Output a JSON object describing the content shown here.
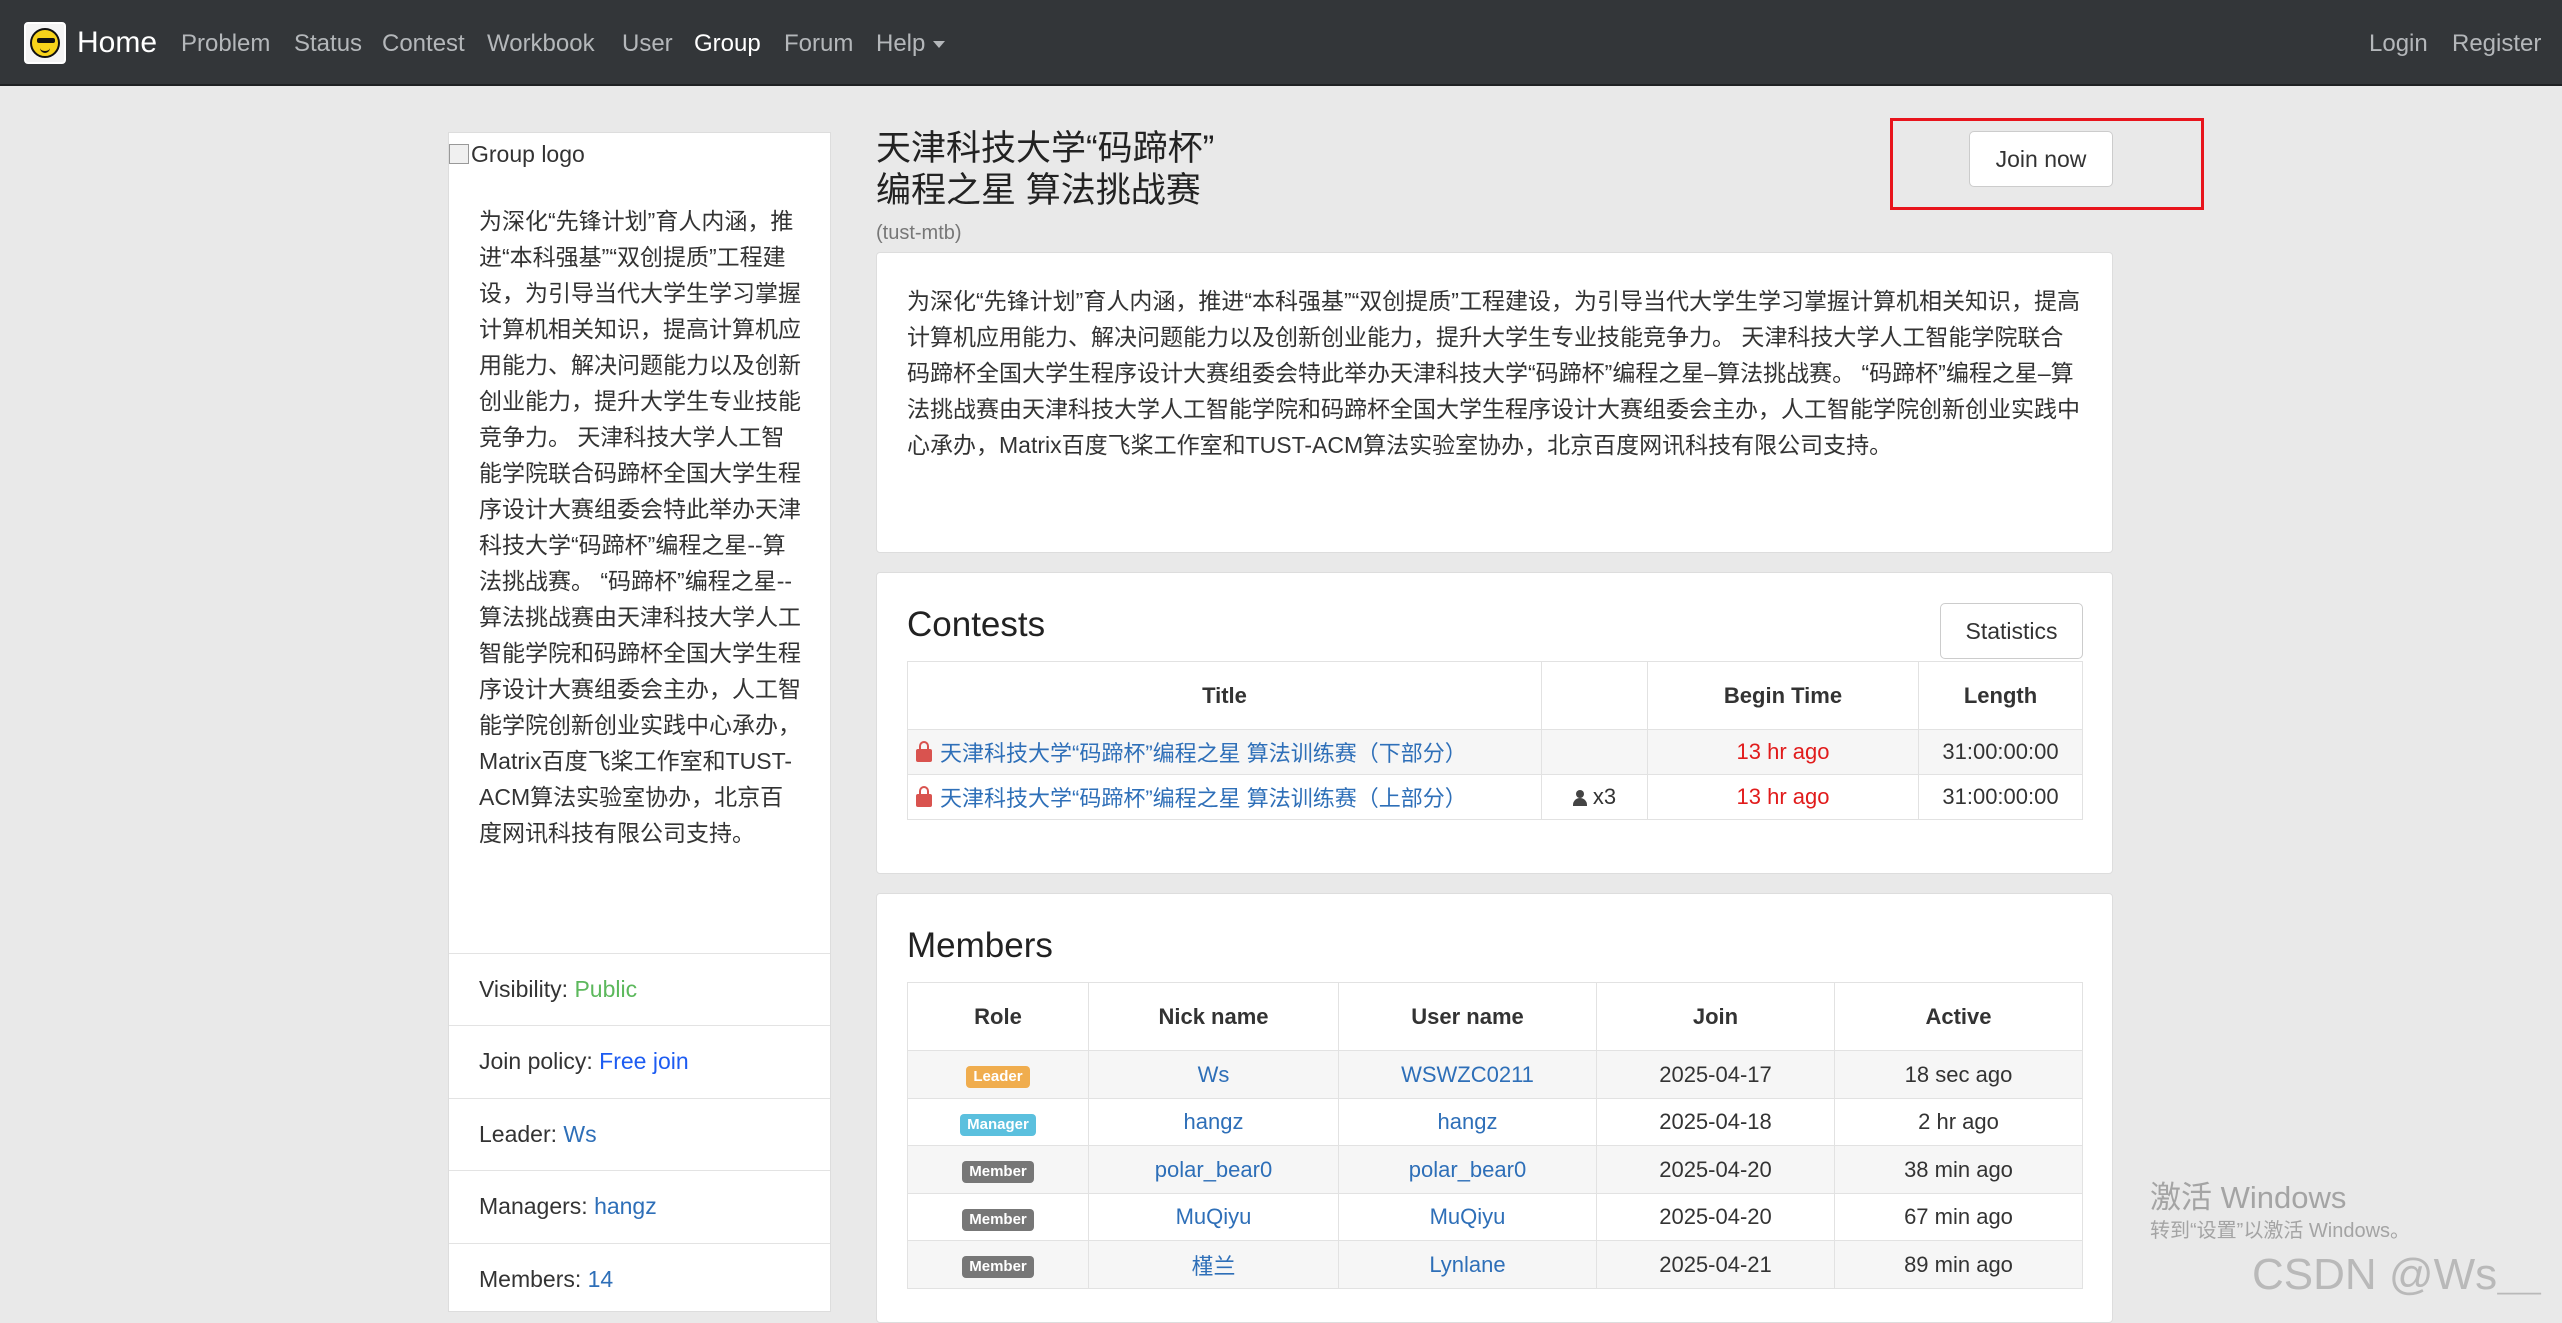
{
  "navbar": {
    "brand": "Home",
    "items": [
      "Problem",
      "Status",
      "Contest",
      "Workbook",
      "User",
      "Group",
      "Forum",
      "Help"
    ],
    "active": "Group",
    "login": "Login",
    "register": "Register"
  },
  "sidebar": {
    "logo_alt": "Group logo",
    "description": "为深化“先锋计划”育人内涵，推进“本科强基”“双创提质”工程建设，为引导当代大学生学习掌握计算机相关知识，提高计算机应用能力、解决问题能力以及创新创业能力，提升大学生专业技能竞争力。 天津科技大学人工智能学院联合码蹄杯全国大学生程序设计大赛组委会特此举办天津科技大学“码蹄杯”编程之星--算法挑战赛。 “码蹄杯”编程之星--算法挑战赛由天津科技大学人工智能学院和码蹄杯全国大学生程序设计大赛组委会主办，人工智能学院创新创业实践中心承办，Matrix百度飞桨工作室和TUST-ACM算法实验室协办，北京百度网讯科技有限公司支持。",
    "visibility_label": "Visibility:",
    "visibility_value": "Public",
    "join_policy_label": "Join policy:",
    "join_policy_value": "Free join",
    "leader_label": "Leader:",
    "leader_value": "Ws",
    "managers_label": "Managers:",
    "managers_value": "hangz",
    "members_label": "Members:",
    "members_value": "14"
  },
  "group": {
    "title_line1": "天津科技大学“码蹄杯”",
    "title_line2": "编程之星 算法挑战赛",
    "name": "(tust-mtb)",
    "join_button": "Join now",
    "description": "为深化“先锋计划”育人内涵，推进“本科强基”“双创提质”工程建设，为引导当代大学生学习掌握计算机相关知识，提高计算机应用能力、解决问题能力以及创新创业能力，提升大学生专业技能竞争力。 天津科技大学人工智能学院联合码蹄杯全国大学生程序设计大赛组委会特此举办天津科技大学“码蹄杯”编程之星–算法挑战赛。 “码蹄杯”编程之星–算法挑战赛由天津科技大学人工智能学院和码蹄杯全国大学生程序设计大赛组委会主办，人工智能学院创新创业实践中心承办，Matrix百度飞桨工作室和TUST-ACM算法实验室协办，北京百度网讯科技有限公司支持。"
  },
  "contests": {
    "heading": "Contests",
    "statistics_button": "Statistics",
    "columns": [
      "Title",
      "",
      "Begin Time",
      "Length"
    ],
    "rows": [
      {
        "title": "天津科技大学“码蹄杯”编程之星 算法训练赛（下部分）",
        "participants": "",
        "begin": "13 hr ago",
        "length": "31:00:00:00"
      },
      {
        "title": "天津科技大学“码蹄杯”编程之星 算法训练赛（上部分）",
        "participants": "x3",
        "begin": "13 hr ago",
        "length": "31:00:00:00"
      }
    ]
  },
  "members": {
    "heading": "Members",
    "columns": [
      "Role",
      "Nick name",
      "User name",
      "Join",
      "Active"
    ],
    "rows": [
      {
        "role": "Leader",
        "nick": "Ws",
        "user": "WSWZC0211",
        "join": "2025-04-17",
        "active": "18 sec ago"
      },
      {
        "role": "Manager",
        "nick": "hangz",
        "user": "hangz",
        "join": "2025-04-18",
        "active": "2 hr ago"
      },
      {
        "role": "Member",
        "nick": "polar_bear0",
        "user": "polar_bear0",
        "join": "2025-04-20",
        "active": "38 min ago"
      },
      {
        "role": "Member",
        "nick": "MuQiyu",
        "user": "MuQiyu",
        "join": "2025-04-20",
        "active": "67 min ago"
      },
      {
        "role": "Member",
        "nick": "槿兰",
        "user": "Lynlane",
        "join": "2025-04-21",
        "active": "89 min ago"
      }
    ]
  },
  "overlay": {
    "activate_title": "激活 Windows",
    "activate_sub": "转到“设置”以激活 Windows。",
    "csdn": "CSDN @Ws＿"
  },
  "colors": {
    "navbar_bg": "#333639",
    "leader_badge": "#f0ad4e",
    "manager_badge": "#5bc0de",
    "member_badge": "#777777",
    "public_green": "#5cb85c",
    "highlight_red": "#e8141c"
  }
}
